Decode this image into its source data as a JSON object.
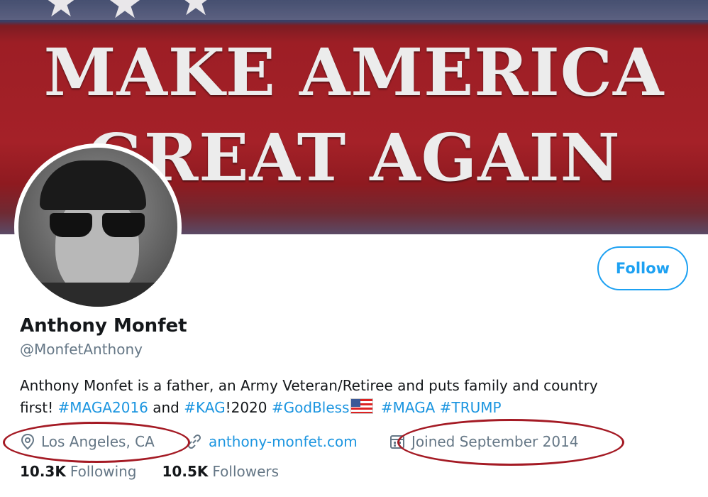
{
  "banner": {
    "line1": "MAKE AMERICA",
    "line2": "GREAT AGAIN"
  },
  "profile": {
    "name": "Anthony Monfet",
    "handle": "@MonfetAnthony",
    "follow_label": "Follow",
    "bio": {
      "line1": "Anthony Monfet is a father, an Army Veteran/Retiree and puts family and country",
      "prefix": "first! ",
      "tag1": "#MAGA2016",
      "and": " and ",
      "tag2": "#KAG",
      "year": "!2020 ",
      "tag3": "#GodBless",
      "tag4": "#MAGA",
      "tag5": "#TRUMP"
    },
    "location": "Los Angeles, CA",
    "website": "anthony-monfet.com",
    "joined": "Joined September 2014",
    "following_count": "10.3K",
    "following_label": "Following",
    "followers_count": "10.5K",
    "followers_label": "Followers"
  },
  "colors": {
    "accent": "#1da1f2",
    "link": "#1b95e0",
    "muted": "#657786",
    "annotation": "#a41a24"
  },
  "icons": {
    "location": "location-pin-icon",
    "link": "link-icon",
    "calendar": "calendar-icon",
    "flag": "us-flag-icon"
  }
}
